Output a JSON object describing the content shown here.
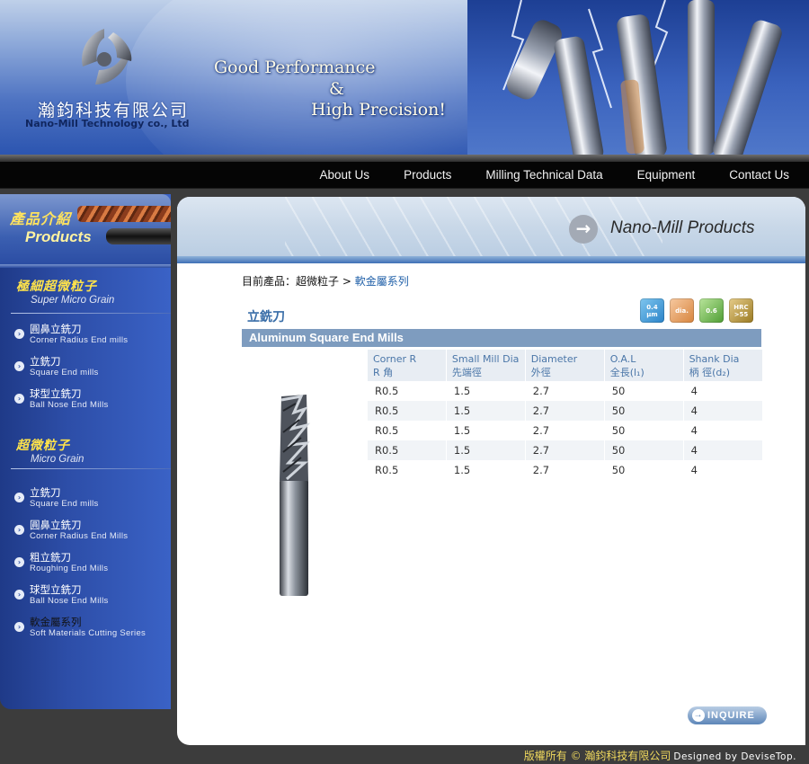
{
  "header": {
    "company_cn": "瀚鈞科技有限公司",
    "company_en": "Nano-Mill Technology co., Ltd",
    "slogan_line1": "Good Performance",
    "slogan_line2": "&",
    "slogan_line3": "High Precision!"
  },
  "nav": {
    "items": [
      "About Us",
      "Products",
      "Milling Technical Data",
      "Equipment",
      "Contact Us"
    ]
  },
  "sidebar": {
    "head_cn": "產品介紹",
    "head_en": "Products",
    "sections": [
      {
        "title_cn": "極細超微粒子",
        "title_en": "Super Micro Grain",
        "items": [
          {
            "cn": "圓鼻立銑刀",
            "en": "Corner Radius End mills"
          },
          {
            "cn": "立銑刀",
            "en": "Square End mills"
          },
          {
            "cn": "球型立銑刀",
            "en": "Ball Nose End Mills"
          }
        ]
      },
      {
        "title_cn": "超微粒子",
        "title_en": "Micro Grain",
        "items": [
          {
            "cn": "立銑刀",
            "en": "Square End mills"
          },
          {
            "cn": "圓鼻立銑刀",
            "en": "Corner Radius End Mills"
          },
          {
            "cn": "粗立銑刀",
            "en": "Roughing End Mills"
          },
          {
            "cn": "球型立銑刀",
            "en": "Ball Nose End Mills"
          },
          {
            "cn": "軟金屬系列",
            "en": "Soft Materials Cutting Series"
          }
        ]
      }
    ]
  },
  "content": {
    "header_title": "Nano-Mill Products",
    "breadcrumb_prefix": "目前產品：超微粒子 > ",
    "breadcrumb_current": "軟金屬系列",
    "section_title": "立銑刀",
    "badges": [
      "0.4 μm",
      "dia.",
      "0.6",
      "HRC >55"
    ],
    "product_bar": "Aluminum Square End Mills",
    "table": {
      "headers": [
        {
          "en": "Corner R",
          "cn": "R 角"
        },
        {
          "en": "Small Mill Dia",
          "cn": "先端徑"
        },
        {
          "en": "Diameter",
          "cn": "外徑"
        },
        {
          "en": "O.A.L",
          "cn": "全長(l₁)"
        },
        {
          "en": "Shank Dia",
          "cn": "柄 徑(d₂)"
        }
      ],
      "rows": [
        [
          "R0.5",
          "1.5",
          "2.7",
          "50",
          "4"
        ],
        [
          "R0.5",
          "1.5",
          "2.7",
          "50",
          "4"
        ],
        [
          "R0.5",
          "1.5",
          "2.7",
          "50",
          "4"
        ],
        [
          "R0.5",
          "1.5",
          "2.7",
          "50",
          "4"
        ],
        [
          "R0.5",
          "1.5",
          "2.7",
          "50",
          "4"
        ]
      ]
    },
    "inquire_label": "INQUIRE"
  },
  "footer": {
    "copyright": "版權所有 © 瀚鈞科技有限公司",
    "designer": "Designed by DeviseTop."
  },
  "colors": {
    "nav_bg": "#050505",
    "sidebar_accent": "#ffe34a",
    "table_header_text": "#4a76a8",
    "product_bar": "#7e9cbf",
    "footer_text": "#f0d95d"
  }
}
